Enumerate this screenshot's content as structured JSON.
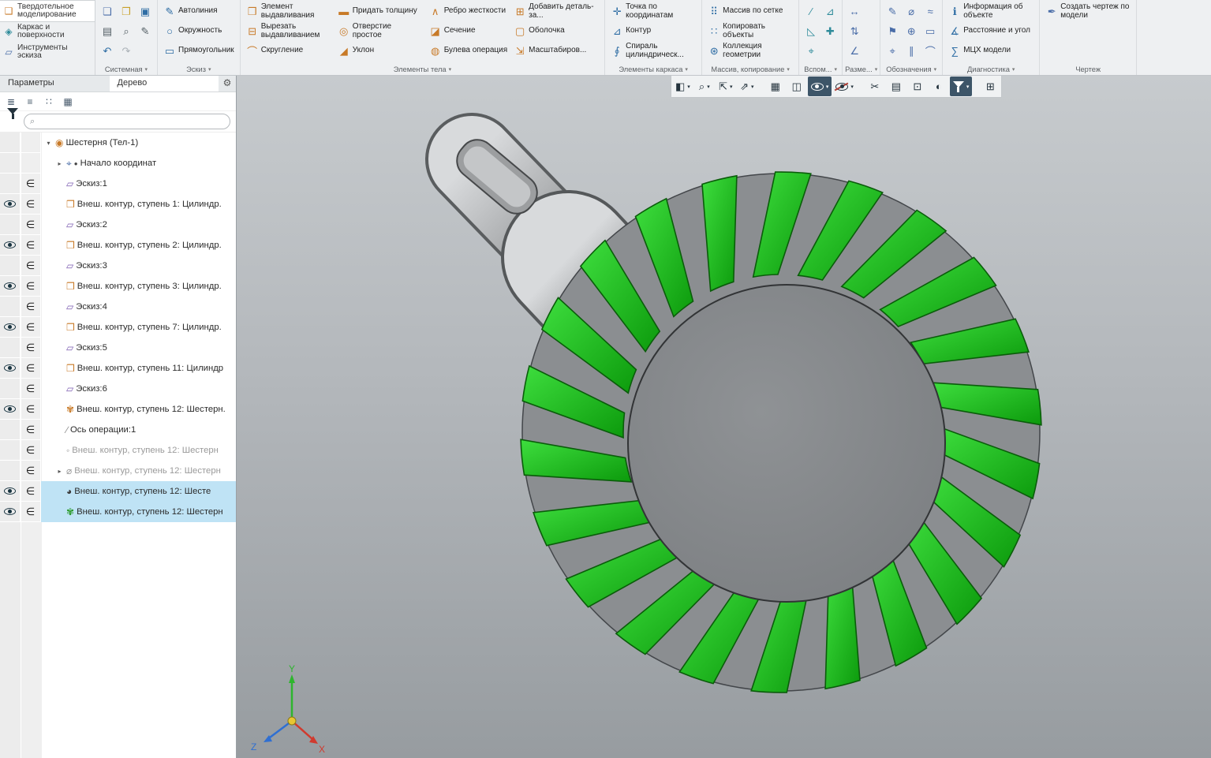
{
  "colors": {
    "highlight_green": "#1db31d",
    "selection_blue": "#bfe3f5",
    "ribbon_bg": "#eef0f2",
    "viewport_top": "#c7cbce",
    "viewport_bottom": "#979ca0"
  },
  "ribbon": {
    "mode_tabs": [
      {
        "name": "solid-modeling",
        "label": "Твердотельное моделирование",
        "icon": "solid-modeling-icon",
        "glyph": "❑",
        "color": "#c87a28",
        "active": true
      },
      {
        "name": "wireframe-surfaces",
        "label": "Каркас и поверхности",
        "icon": "wireframe-surfaces-icon",
        "glyph": "◈",
        "color": "#2e8b9a",
        "active": false
      },
      {
        "name": "sketch-tools",
        "label": "Инструменты эскиза",
        "icon": "sketch-tools-icon",
        "glyph": "▱",
        "color": "#4a6da8",
        "active": false
      }
    ],
    "groups": [
      {
        "label": "Системная",
        "arrow": true,
        "columns": [
          {
            "buttons": [
              {
                "icon": "new-document-icon",
                "glyph": "❏",
                "color": "#4a6da8"
              },
              {
                "icon": "print-icon",
                "glyph": "▤",
                "color": "#556066"
              },
              {
                "icon": "undo-icon",
                "glyph": "↶",
                "color": "#2e6da4"
              }
            ]
          },
          {
            "buttons": [
              {
                "icon": "open-document-icon",
                "glyph": "❐",
                "color": "#c8a028"
              },
              {
                "icon": "print-preview-icon",
                "glyph": "⌕",
                "color": "#556066"
              },
              {
                "icon": "redo-icon",
                "glyph": "↷",
                "color": "#aab1b7"
              }
            ]
          },
          {
            "buttons": [
              {
                "icon": "save-icon",
                "glyph": "▣",
                "color": "#2e6da4"
              },
              {
                "icon": "save-as-icon",
                "glyph": "✎",
                "color": "#556066"
              }
            ]
          }
        ]
      },
      {
        "label": "Эскиз",
        "arrow": true,
        "columns": [
          {
            "buttons": [
              {
                "icon": "autoline-icon",
                "glyph": "✎",
                "color": "#2e6da4",
                "label": "Автолиния"
              },
              {
                "icon": "circle-icon",
                "glyph": "○",
                "color": "#2e6da4",
                "label": "Окружность"
              },
              {
                "icon": "rectangle-icon",
                "glyph": "▭",
                "color": "#2e6da4",
                "label": "Прямоугольник"
              }
            ]
          }
        ]
      },
      {
        "label": "Элементы тела",
        "arrow": true,
        "columns": [
          {
            "buttons": [
              {
                "icon": "extrude-icon",
                "glyph": "❒",
                "color": "#c87a28",
                "label": "Элемент выдавливания"
              },
              {
                "icon": "cut-extrude-icon",
                "glyph": "⊟",
                "color": "#c87a28",
                "label": "Вырезать выдавливанием"
              },
              {
                "icon": "fillet-icon",
                "glyph": "⌒",
                "color": "#c87a28",
                "label": "Скругление"
              }
            ]
          },
          {
            "buttons": [
              {
                "icon": "thicken-icon",
                "glyph": "▬",
                "color": "#c87a28",
                "label": "Придать толщину"
              },
              {
                "icon": "simple-hole-icon",
                "glyph": "◎",
                "color": "#c87a28",
                "label": "Отверстие простое"
              },
              {
                "icon": "draft-icon",
                "glyph": "◢",
                "color": "#c87a28",
                "label": "Уклон"
              }
            ]
          },
          {
            "buttons": [
              {
                "icon": "rib-icon",
                "glyph": "∧",
                "color": "#c87a28",
                "label": "Ребро жесткости"
              },
              {
                "icon": "section-icon",
                "glyph": "◪",
                "color": "#c87a28",
                "label": "Сечение"
              },
              {
                "icon": "boolean-icon",
                "glyph": "◍",
                "color": "#c87a28",
                "label": "Булева операция"
              }
            ]
          },
          {
            "buttons": [
              {
                "icon": "add-part-icon",
                "glyph": "⊞",
                "color": "#c87a28",
                "label": "Добавить деталь-за..."
              },
              {
                "icon": "shell-icon",
                "glyph": "▢",
                "color": "#c87a28",
                "label": "Оболочка"
              },
              {
                "icon": "scale-icon",
                "glyph": "⇲",
                "color": "#c87a28",
                "label": "Масштабиров..."
              }
            ]
          }
        ]
      },
      {
        "label": "Элементы каркаса",
        "arrow": true,
        "columns": [
          {
            "buttons": [
              {
                "icon": "point-by-coordinates-icon",
                "glyph": "✛",
                "color": "#2e6da4",
                "label": "Точка по координатам"
              },
              {
                "icon": "contour-icon",
                "glyph": "⊿",
                "color": "#2e6da4",
                "label": "Контур"
              },
              {
                "icon": "cylindrical-spiral-icon",
                "glyph": "∮",
                "color": "#2e6da4",
                "label": "Спираль цилиндрическ..."
              }
            ]
          }
        ]
      },
      {
        "label": "Массив, копирование",
        "arrow": true,
        "columns": [
          {
            "buttons": [
              {
                "icon": "grid-array-icon",
                "glyph": "⠿",
                "color": "#2e6da4",
                "label": "Массив по сетке"
              },
              {
                "icon": "copy-objects-icon",
                "glyph": "∷",
                "color": "#2e6da4",
                "label": "Копировать объекты"
              },
              {
                "icon": "geometry-collection-icon",
                "glyph": "⊛",
                "color": "#2e6da4",
                "label": "Коллекция геометрии"
              }
            ]
          }
        ]
      },
      {
        "label": "Вспом...",
        "arrow": true,
        "columns": [
          {
            "buttons": [
              {
                "icon": "construction-axis-icon",
                "glyph": "∕",
                "color": "#2e8b9a"
              },
              {
                "icon": "construction-plane-icon",
                "glyph": "◺",
                "color": "#2e8b9a"
              },
              {
                "icon": "local-csys-icon",
                "glyph": "⌖",
                "color": "#2e8b9a"
              }
            ]
          },
          {
            "buttons": [
              {
                "icon": "construction-surface-icon",
                "glyph": "⊿",
                "color": "#2e8b9a"
              },
              {
                "icon": "construction-point-icon",
                "glyph": "✚",
                "color": "#2e8b9a"
              }
            ]
          }
        ]
      },
      {
        "label": "Разме...",
        "arrow": true,
        "columns": [
          {
            "buttons": [
              {
                "icon": "linear-dimension-icon",
                "glyph": "↔",
                "color": "#4a6da8"
              },
              {
                "icon": "vertical-dimension-icon",
                "glyph": "⇅",
                "color": "#4a6da8"
              },
              {
                "icon": "angle-dimension-icon",
                "glyph": "∠",
                "color": "#4a6da8"
              }
            ]
          }
        ]
      },
      {
        "label": "Обозначения",
        "arrow": true,
        "columns": [
          {
            "buttons": [
              {
                "icon": "leader-icon",
                "glyph": "✎",
                "color": "#4a6da8"
              },
              {
                "icon": "datum-icon",
                "glyph": "⚑",
                "color": "#4a6da8"
              },
              {
                "icon": "center-mark-icon",
                "glyph": "⌖",
                "color": "#4a6da8"
              }
            ]
          },
          {
            "buttons": [
              {
                "icon": "diameter-icon",
                "glyph": "⌀",
                "color": "#4a6da8"
              },
              {
                "icon": "position-icon",
                "glyph": "⊕",
                "color": "#4a6da8"
              },
              {
                "icon": "parallel-icon",
                "glyph": "∥",
                "color": "#4a6da8"
              }
            ]
          },
          {
            "buttons": [
              {
                "icon": "roughness-icon",
                "glyph": "≈",
                "color": "#4a6da8"
              },
              {
                "icon": "frame-icon",
                "glyph": "▭",
                "color": "#4a6da8"
              },
              {
                "icon": "arc-note-icon",
                "glyph": "⌒",
                "color": "#4a6da8"
              }
            ]
          }
        ]
      },
      {
        "label": "Диагностика",
        "arrow": true,
        "columns": [
          {
            "buttons": [
              {
                "icon": "object-info-icon",
                "glyph": "ℹ",
                "color": "#2e6da4",
                "label": "Информация об объекте"
              },
              {
                "icon": "distance-angle-icon",
                "glyph": "∡",
                "color": "#2e6da4",
                "label": "Расстояние и угол"
              },
              {
                "icon": "mass-properties-icon",
                "glyph": "∑",
                "color": "#2e6da4",
                "label": "МЦХ модели"
              }
            ]
          }
        ]
      },
      {
        "label": "Чертеж",
        "arrow": false,
        "columns": [
          {
            "buttons": [
              {
                "icon": "create-drawing-icon",
                "glyph": "✒",
                "color": "#4a6da8",
                "label": "Создать чертеж по модели"
              }
            ]
          }
        ]
      }
    ]
  },
  "panel": {
    "tabs": [
      {
        "label": "Параметры",
        "active": false
      },
      {
        "label": "Дерево",
        "active": true
      }
    ],
    "gear_glyph": "⚙",
    "tree_toolbar": [
      {
        "icon": "tree-structure-icon",
        "glyph": "≣"
      },
      {
        "icon": "tree-sequence-icon",
        "glyph": "≡"
      },
      {
        "icon": "tree-relations-icon",
        "glyph": "∷"
      },
      {
        "icon": "tree-area-select-icon",
        "glyph": "▦"
      }
    ],
    "filter": {
      "search_glyph": "⌕",
      "search_placeholder": "",
      "search_value": ""
    },
    "tree": [
      {
        "label": "Шестерня (Тел-1)",
        "icon": "gear-body-icon",
        "glyph": "◉",
        "c": "#c87a28",
        "expander": "▾",
        "level": 0
      },
      {
        "label": "Начало координат",
        "icon": "origin-axes-icon",
        "glyph": "⌖",
        "c": "#4a6da8",
        "bullet": "●",
        "expander": "▸",
        "level": 1
      },
      {
        "label": "Эскиз:1",
        "icon": "sketch-icon",
        "glyph": "▱",
        "c": "#7a5ab0",
        "level": 1,
        "incl": true
      },
      {
        "label": "Внеш. контур, ступень 1: Цилиндр.",
        "icon": "extrude-operation-icon",
        "glyph": "❒",
        "c": "#c87a28",
        "level": 1,
        "incl": true,
        "eye": true
      },
      {
        "label": "Эскиз:2",
        "icon": "sketch-icon",
        "glyph": "▱",
        "c": "#7a5ab0",
        "level": 1,
        "incl": true
      },
      {
        "label": "Внеш. контур, ступень 2: Цилиндр.",
        "icon": "extrude-operation-icon",
        "glyph": "❒",
        "c": "#c87a28",
        "level": 1,
        "incl": true,
        "eye": true
      },
      {
        "label": "Эскиз:3",
        "icon": "sketch-icon",
        "glyph": "▱",
        "c": "#7a5ab0",
        "level": 1,
        "incl": true
      },
      {
        "label": "Внеш. контур, ступень 3: Цилиндр.",
        "icon": "extrude-operation-icon",
        "glyph": "❒",
        "c": "#c87a28",
        "level": 1,
        "incl": true,
        "eye": true
      },
      {
        "label": "Эскиз:4",
        "icon": "sketch-icon",
        "glyph": "▱",
        "c": "#7a5ab0",
        "level": 1,
        "incl": true
      },
      {
        "label": "Внеш. контур, ступень 7: Цилиндр.",
        "icon": "extrude-operation-icon",
        "glyph": "❒",
        "c": "#c87a28",
        "level": 1,
        "incl": true,
        "eye": true
      },
      {
        "label": "Эскиз:5",
        "icon": "sketch-icon",
        "glyph": "▱",
        "c": "#7a5ab0",
        "level": 1,
        "incl": true
      },
      {
        "label": "Внеш. контур, ступень 11: Цилиндр",
        "icon": "extrude-operation-icon",
        "glyph": "❒",
        "c": "#c87a28",
        "level": 1,
        "incl": true,
        "eye": true
      },
      {
        "label": "Эскиз:6",
        "icon": "sketch-icon",
        "glyph": "▱",
        "c": "#7a5ab0",
        "level": 1,
        "incl": true
      },
      {
        "label": "Внеш. контур, ступень 12: Шестерн.",
        "icon": "gear-operation-icon",
        "glyph": "✾",
        "c": "#c87a28",
        "level": 1,
        "incl": true,
        "eye": true
      },
      {
        "label": "Ось операции:1",
        "icon": "axis-icon",
        "glyph": "∕",
        "c": "#888888",
        "level": 1,
        "incl": true
      },
      {
        "label": "Внеш. контур, ступень 12: Шестерн",
        "icon": "suppressed-operation-icon",
        "glyph": "◦",
        "c": "#999999",
        "level": 1,
        "incl": true,
        "muted": true
      },
      {
        "label": "Внеш. контур, ступень 12: Шестерн",
        "icon": "suppressed-operation-icon",
        "glyph": "⌀",
        "c": "#999999",
        "expander": "▸",
        "level": 1,
        "incl": true,
        "muted": true
      },
      {
        "label": "Внеш. контур, ступень 12: Шесте",
        "icon": "appearance-operation-icon",
        "glyph": "◕",
        "c": "#3a3a3a",
        "level": 1,
        "incl": true,
        "eye": true,
        "selected": true
      },
      {
        "label": "Внеш. контур, ступень 12: Шестерн",
        "icon": "gear-operation-icon",
        "glyph": "✾",
        "c": "#2a9a2a",
        "level": 1,
        "incl": true,
        "eye": true,
        "selected": true
      }
    ]
  },
  "viewport": {
    "toolbar": [
      {
        "icon": "coordinate-plane-icon",
        "glyph": "◧",
        "dropdown": true
      },
      {
        "icon": "zoom-icon",
        "glyph": "⌕",
        "dropdown": true
      },
      {
        "icon": "orientation-icon",
        "glyph": "⇱",
        "dropdown": true
      },
      {
        "icon": "view-direction-icon",
        "glyph": "⇗",
        "dropdown": true
      },
      {
        "icon": "shaded-view-icon",
        "glyph": "▦",
        "gap": true
      },
      {
        "icon": "wireframe-view-icon",
        "glyph": "◫"
      },
      {
        "icon": "show-objects-icon",
        "special": "eye",
        "dropdown": true,
        "pressed": true
      },
      {
        "icon": "hide-objects-icon",
        "special": "eye-off",
        "dropdown": true
      },
      {
        "icon": "section-view-icon",
        "glyph": "✂",
        "gap": true
      },
      {
        "icon": "clip-box-icon",
        "glyph": "▤"
      },
      {
        "icon": "clip-plane-icon",
        "glyph": "⊡"
      },
      {
        "icon": "appearance-icon",
        "glyph": "◐"
      },
      {
        "icon": "scene-filter-icon",
        "special": "funnel",
        "dropdown": true,
        "pressed": true
      },
      {
        "icon": "measure-grid-icon",
        "glyph": "⊞",
        "gap": true
      }
    ],
    "triad": {
      "x": "X",
      "y": "Y",
      "z": "Z",
      "x_color": "#d03a2e",
      "y_color": "#2eb52e",
      "z_color": "#2f6fd2"
    }
  }
}
